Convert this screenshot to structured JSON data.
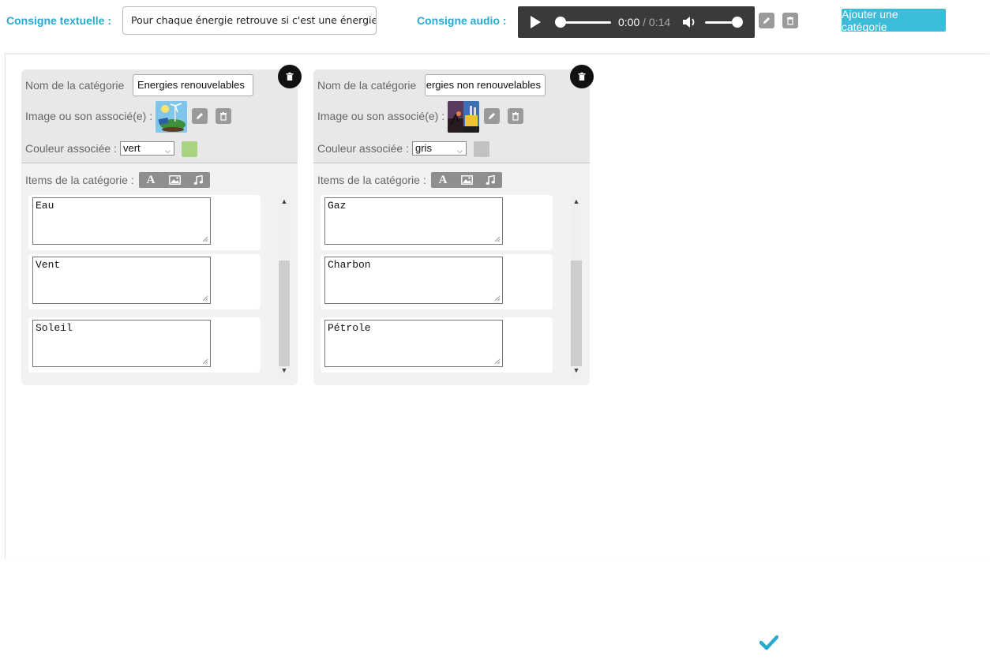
{
  "header": {
    "text_instruction_label": "Consigne textuelle :",
    "text_instruction_value": "Pour chaque énergie retrouve si c'est une énergie re",
    "audio_instruction_label": "Consigne audio :",
    "audio": {
      "current_time": "0:00",
      "separator": " / ",
      "duration": "0:14",
      "progress": 0.0,
      "volume": 1.0
    },
    "add_category_label": "Ajouter une catégorie"
  },
  "labels": {
    "category_name": "Nom de la catégorie",
    "associated_media": "Image ou son associé(e) :",
    "associated_color": "Couleur associée :",
    "category_items": "Items de la catégorie :"
  },
  "categories": [
    {
      "name": "Energies renouvelables",
      "color_option": "vert",
      "color_hex": "#a7d382",
      "image_icon": "renewable-energy-image",
      "items": [
        "Eau",
        "Vent",
        "Soleil"
      ]
    },
    {
      "name": "Energies non renouvelables",
      "color_option": "gris",
      "color_hex": "#c2c2c2",
      "image_icon": "nonrenewable-energy-image",
      "items": [
        "Gaz",
        "Charbon",
        "Pétrole"
      ]
    }
  ],
  "colors": {
    "accent": "#29a9d0",
    "button": "#3bbcd9",
    "player_bg": "#3a3a3a",
    "icon_gray": "#9a9a9a"
  }
}
